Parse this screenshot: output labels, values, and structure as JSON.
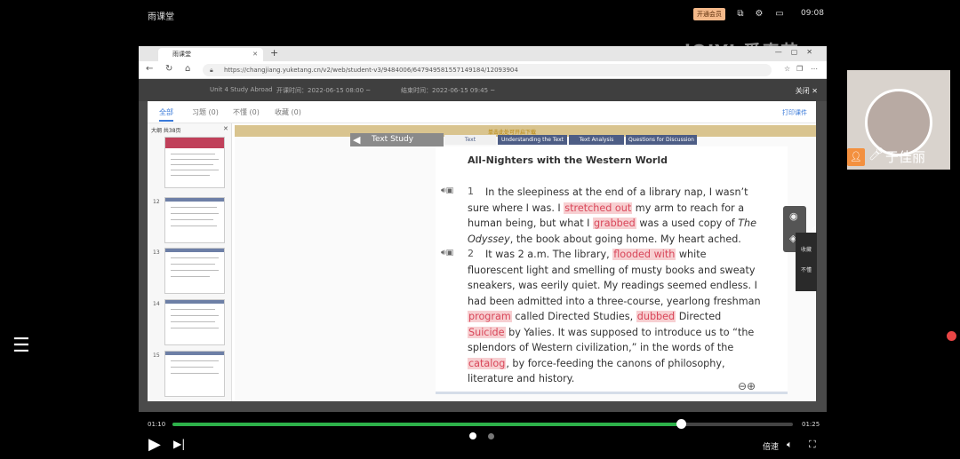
{
  "phone": {
    "app_title": "雨课堂",
    "vip_label": "开通会员",
    "time": "09:08",
    "watermark": "iQIYI 爱奇艺"
  },
  "browser": {
    "tab_title": "雨课堂",
    "url": "https://changjiang.yuketang.cn/v2/web/student-v3/9484006/647949581557149184/12093904"
  },
  "header": {
    "lesson": "Unit 4 Study Abroad",
    "start": "开课时间：2022-06-15 08:00 ~",
    "end": "结束时间：2022-06-15 09:45 ~",
    "close": "关闭 ✕"
  },
  "tabs": [
    "全部",
    "习题 (0)",
    "不懂 (0)",
    "收藏 (0)"
  ],
  "print": "打印课件",
  "thumbs": {
    "header": "大纲 共38页",
    "pages": [
      "12",
      "13",
      "14",
      "15"
    ]
  },
  "slide": {
    "hint": "单击此处可开启下载",
    "text_study": "Text Study",
    "tabs": [
      "Text",
      "Understanding the Text",
      "Text Analysis",
      "Questions for Discussion"
    ],
    "title": "All-Nighters with the Western World",
    "p1_num": "1",
    "p1": {
      "a": "In the sleepiness at the end of a library nap, I wasn’t sure where I was. I ",
      "h1": "stretched out",
      "b": " my arm to reach for a human being, but what I ",
      "h2": "grabbed",
      "c": " was a used copy of ",
      "italic": "The Odyssey",
      "d": ", the book about going home. My heart ached."
    },
    "p2_num": "2",
    "p2": {
      "a": "It was 2 a.m. The library, ",
      "h1": "flooded with",
      "b": " white fluorescent light and smelling of musty books and sweaty sneakers, was eerily quiet. My readings seemed endless. I had been admitted into a three-course, yearlong freshman ",
      "h2": "program",
      "c": " called Directed Studies, ",
      "h3": "dubbed",
      "d": " Directed ",
      "h4": "Suicide",
      "e": " by Yalies. It was supposed to introduce us to “the splendors of Western civilization,” in the words of the ",
      "h5": "catalog",
      "f": ", by force-feeding the canons of philosophy, literature and history."
    }
  },
  "side_tools": {
    "collect": "收藏",
    "not_understand": "不懂"
  },
  "webcam": {
    "name": "于佳丽"
  },
  "player": {
    "current": "01:10",
    "total": "01:25",
    "progress": 0.82,
    "speed": "倍速"
  }
}
